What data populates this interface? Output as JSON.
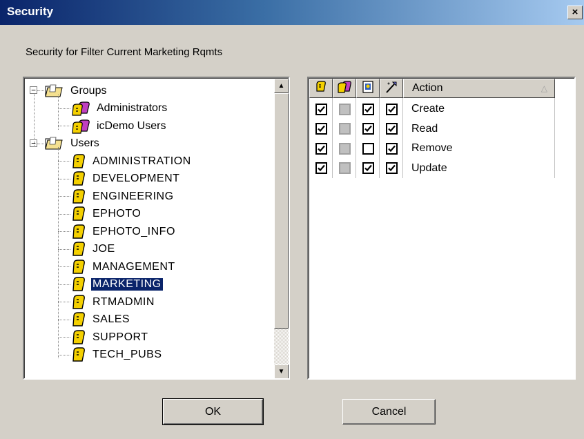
{
  "window": {
    "title": "Security",
    "close_glyph": "×"
  },
  "heading": "Security for Filter Current Marketing Rqmts",
  "tree": {
    "groups": {
      "label": "Groups",
      "expander": "−",
      "icon": "folder-open-icon",
      "items": [
        {
          "label": "Administrators",
          "icon": "group-icon"
        },
        {
          "label": "icDemo Users",
          "icon": "group-icon"
        }
      ]
    },
    "users": {
      "label": "Users",
      "expander": "−",
      "icon": "folder-open-icon",
      "items": [
        {
          "label": "ADMINISTRATION",
          "icon": "user-icon"
        },
        {
          "label": "DEVELOPMENT",
          "icon": "user-icon"
        },
        {
          "label": "ENGINEERING",
          "icon": "user-icon"
        },
        {
          "label": "EPHOTO",
          "icon": "user-icon"
        },
        {
          "label": "EPHOTO_INFO",
          "icon": "user-icon"
        },
        {
          "label": "JOE",
          "icon": "user-icon"
        },
        {
          "label": "MANAGEMENT",
          "icon": "user-icon"
        },
        {
          "label": "MARKETING",
          "icon": "user-icon",
          "selected": true
        },
        {
          "label": "RTMADMIN",
          "icon": "user-icon"
        },
        {
          "label": "SALES",
          "icon": "user-icon"
        },
        {
          "label": "SUPPORT",
          "icon": "user-icon"
        },
        {
          "label": "TECH_PUBS",
          "icon": "user-icon"
        }
      ]
    },
    "scroll": {
      "up_glyph": "▲",
      "down_glyph": "▼"
    }
  },
  "actions": {
    "header": {
      "column_icons": [
        "user-icon",
        "group-icon",
        "inherit-icon",
        "wand-icon"
      ],
      "action_label": "Action",
      "sort_glyph": "△"
    },
    "rows": [
      {
        "label": "Create",
        "checks": [
          true,
          null,
          true,
          true
        ]
      },
      {
        "label": "Read",
        "checks": [
          true,
          null,
          true,
          true
        ]
      },
      {
        "label": "Remove",
        "checks": [
          true,
          null,
          false,
          true
        ]
      },
      {
        "label": "Update",
        "checks": [
          true,
          null,
          true,
          true
        ]
      }
    ]
  },
  "buttons": {
    "ok": "OK",
    "cancel": "Cancel"
  },
  "colors": {
    "selection": "#0a246a",
    "titlebar_start": "#0a246a",
    "titlebar_end": "#a6caf0",
    "face": "#d4d0c8"
  }
}
